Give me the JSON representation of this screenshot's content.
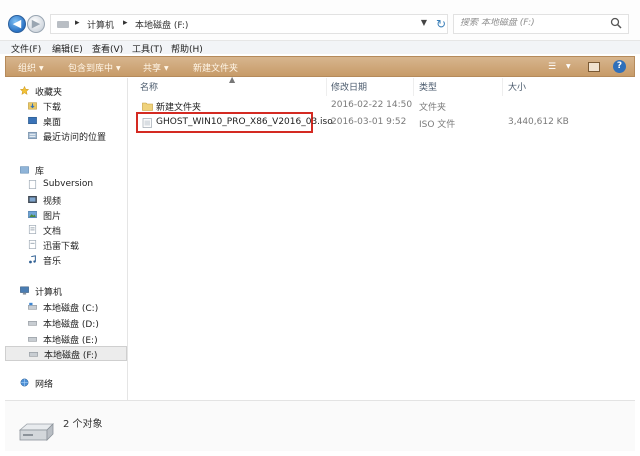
{
  "address": {
    "segments": [
      "计算机",
      "本地磁盘 (F:)"
    ],
    "search_placeholder": "搜索 本地磁盘 (F:)"
  },
  "menu": [
    "文件(F)",
    "编辑(E)",
    "查看(V)",
    "工具(T)",
    "帮助(H)"
  ],
  "toolbar": {
    "organize": "组织",
    "include_library": "包含到库中",
    "share": "共享",
    "new_folder": "新建文件夹"
  },
  "nav": {
    "favorites": {
      "label": "收藏夹",
      "items": [
        "下载",
        "桌面",
        "最近访问的位置"
      ]
    },
    "libraries": {
      "label": "库",
      "items": [
        "Subversion",
        "视频",
        "图片",
        "文档",
        "迅雷下载",
        "音乐"
      ]
    },
    "computer": {
      "label": "计算机",
      "items": [
        "本地磁盘 (C:)",
        "本地磁盘 (D:)",
        "本地磁盘 (E:)",
        "本地磁盘 (F:)"
      ]
    },
    "network": {
      "label": "网络"
    }
  },
  "columns": {
    "name": "名称",
    "date": "修改日期",
    "type": "类型",
    "size": "大小"
  },
  "files": [
    {
      "name": "新建文件夹",
      "date": "2016-02-22 14:50",
      "type": "文件夹",
      "size": "",
      "icon": "folder-icon"
    },
    {
      "name": "GHOST_WIN10_PRO_X86_V2016_03.iso",
      "date": "2016-03-01 9:52",
      "type": "ISO 文件",
      "size": "3,440,612 KB",
      "icon": "iso-file-icon"
    }
  ],
  "status": {
    "count": "2 个对象"
  },
  "colors": {
    "toolbar": "#c79b68",
    "highlight": "#d42a22",
    "accent": "#2f6fba"
  }
}
